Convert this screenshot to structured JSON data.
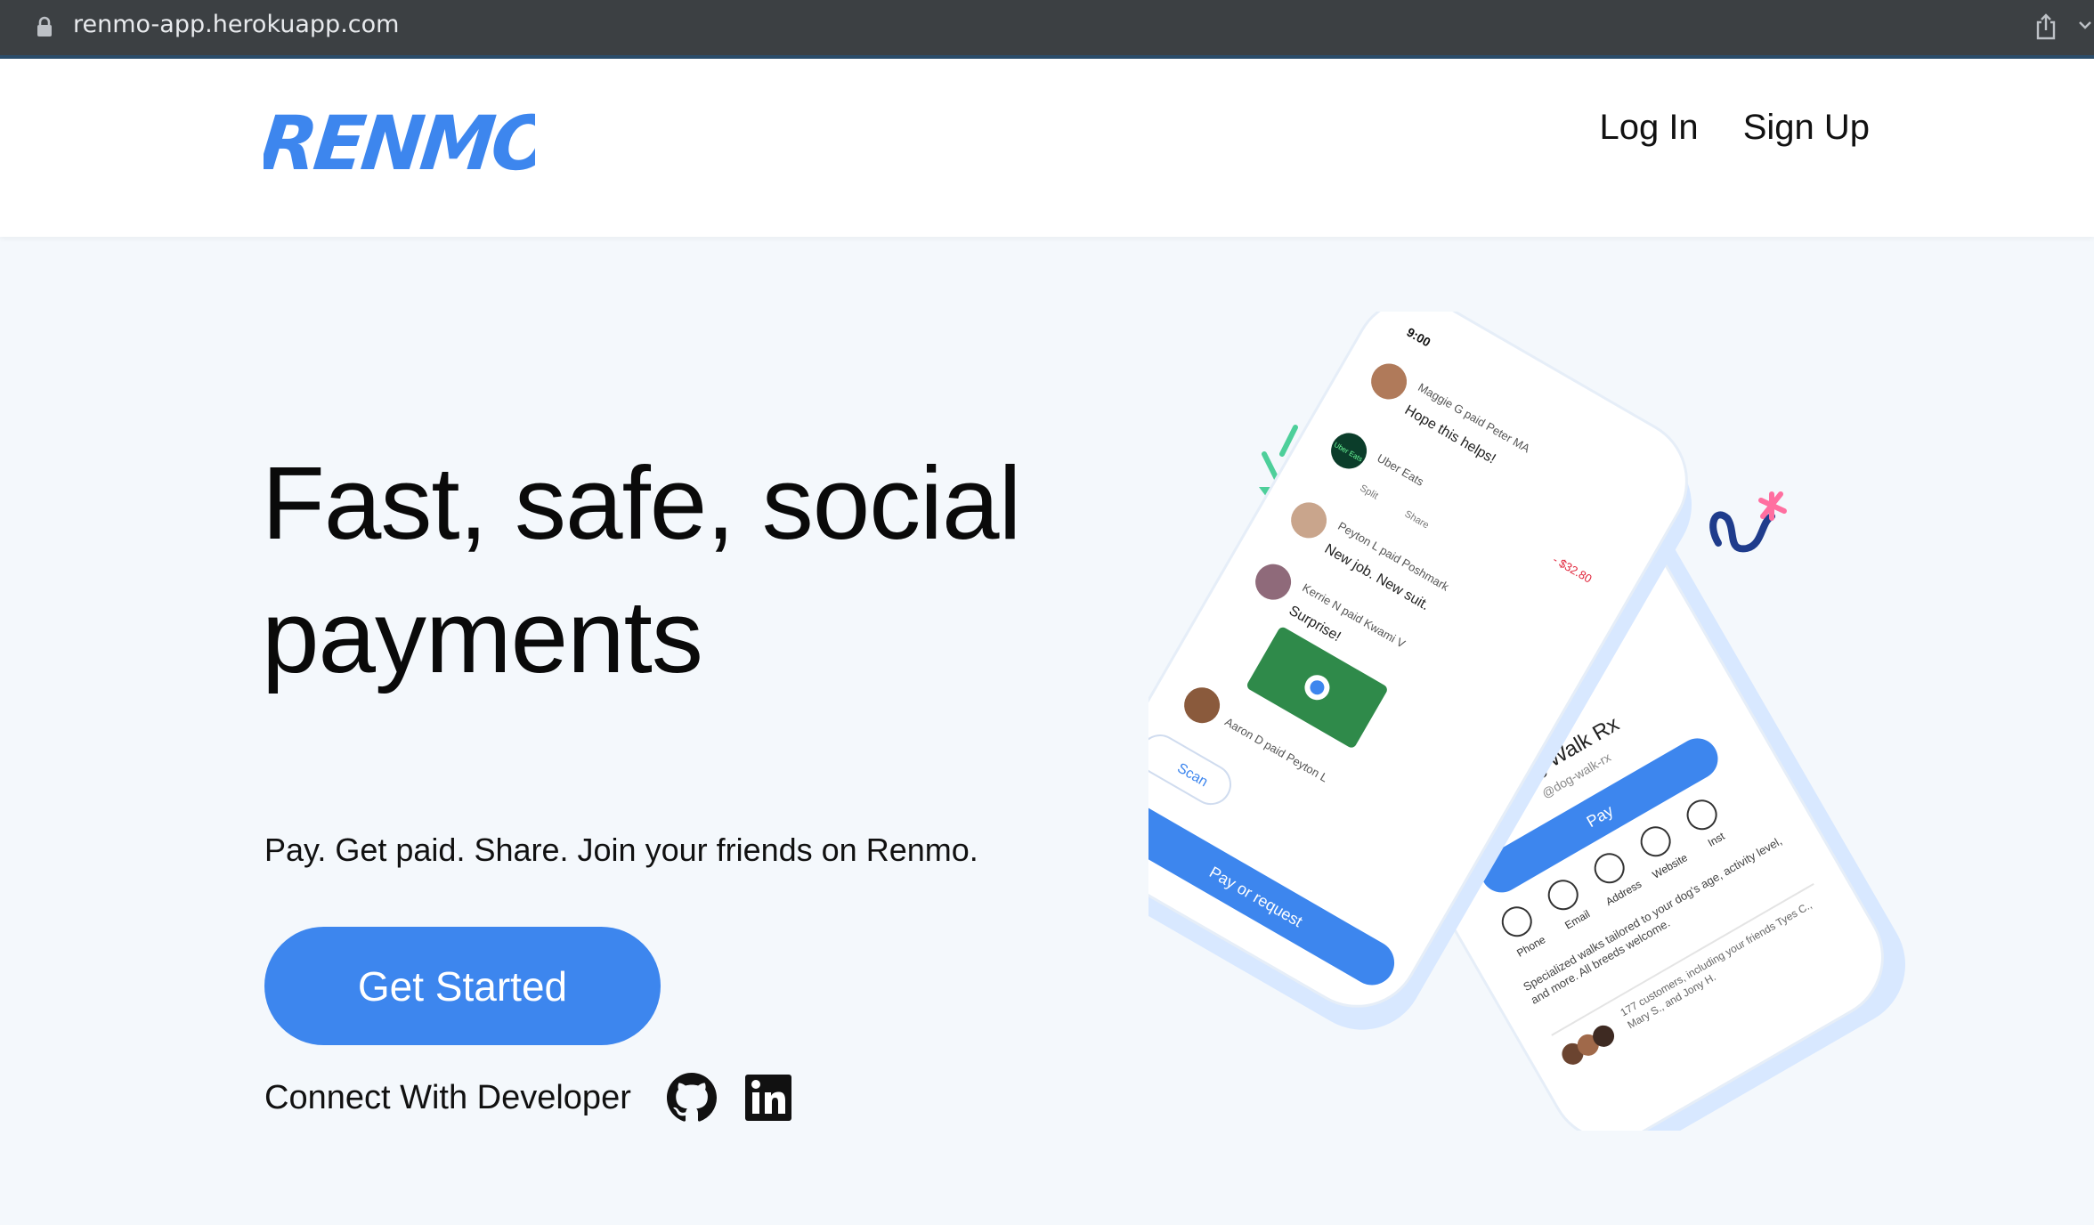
{
  "browser": {
    "url": "renmo-app.herokuapp.com"
  },
  "navbar": {
    "logo_text": "RENMO",
    "login_label": "Log In",
    "signup_label": "Sign Up"
  },
  "hero": {
    "title_line1": "Fast, safe, social",
    "title_line2": "payments",
    "subtitle": "Pay. Get paid. Share. Join your friends on Renmo.",
    "cta_label": "Get Started",
    "connect_label": "Connect With Developer"
  },
  "phone_feed": {
    "time": "9:00",
    "items": [
      {
        "name": "Maggie G paid Peter MA",
        "note": "Hope this helps!"
      },
      {
        "name": "Uber Eats",
        "amount": "- $32.80",
        "badge": "Uber Eats"
      },
      {
        "name": "Peyton L paid Poshmark",
        "note": "New job. New suit."
      },
      {
        "name": "Kerrie N paid Kwami V",
        "note": "Surprise!"
      },
      {
        "name": "Aaron D paid Peyton L"
      }
    ],
    "actions": [
      "Split",
      "Share"
    ],
    "scan_label": "Scan",
    "pay_request_label": "Pay or request"
  },
  "phone_profile": {
    "name": "Dog Walk Rx",
    "handle": "@dog-walk-rx",
    "pay_label": "Pay",
    "contact_labels": [
      "Phone",
      "Email",
      "Address",
      "Website",
      "Inst"
    ],
    "description": "Specialized walks tailored to your dog's age, activity level, and more. All breeds welcome.",
    "customers": "177 customers, including your friends Tyes C., Mary S., and Jony H."
  },
  "colors": {
    "accent": "#3d86ee",
    "page_bg": "#f4f8fc",
    "nav_bg": "#ffffff",
    "browser_bar": "#3c4043"
  },
  "icons": {
    "lock": "lock-icon",
    "share": "share-icon",
    "github": "github-icon",
    "linkedin": "linkedin-icon"
  }
}
